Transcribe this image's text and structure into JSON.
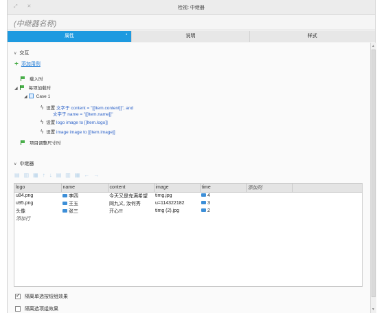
{
  "window": {
    "title": "检视: 中继器"
  },
  "widget_name": "(中继器名称)",
  "tabs": [
    {
      "label": "属性"
    },
    {
      "label": "说明"
    },
    {
      "label": "样式"
    }
  ],
  "interaction": {
    "header": "交互",
    "add_case": "添加用例",
    "events": [
      {
        "label": "载入时"
      },
      {
        "label": "每项加载时"
      },
      {
        "label": "项目调整尺寸时"
      }
    ],
    "case_name": "Case 1",
    "actions": [
      {
        "key": "设置",
        "line1": "文字于 content = \"[[Item.content]]\", and",
        "line2": "文字于 name = \"[[Item.name]]\""
      },
      {
        "key": "设置",
        "line1": "logo image to [[Item.logo]]"
      },
      {
        "key": "设置",
        "line1": "image image to [[Item.image]]"
      }
    ]
  },
  "repeater": {
    "header": "中继器",
    "columns": [
      "logo",
      "name",
      "content",
      "image",
      "time",
      "添加列"
    ],
    "rows": [
      [
        "u84.png",
        "李四",
        "今天又是充满希望",
        "timg.jpg",
        "4"
      ],
      [
        "u95.png",
        "王五",
        "同九义, 汝何秀",
        "u=114322182",
        "3"
      ],
      [
        "头像",
        "张三",
        "开心!!!",
        "timg (2).jpg",
        "2"
      ]
    ],
    "add_row": "添加行"
  },
  "options": {
    "checkbox1": "隔离单选按钮组效果",
    "checkbox2": "隔离选项组效果"
  },
  "colors": {
    "accent": "#1e9ae0",
    "link": "#1e7ad6"
  }
}
